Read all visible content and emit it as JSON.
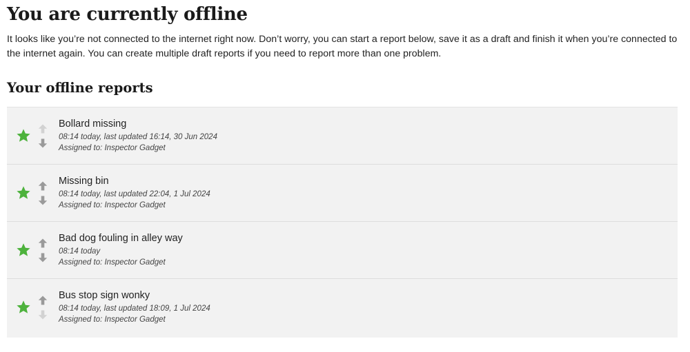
{
  "header": {
    "title": "You are currently offline",
    "intro": "It looks like you’re not connected to the internet right now. Don’t worry, you can start a report below, save it as a draft and finish it when you’re connected to the internet again. You can create multiple draft reports if you need to report more than one problem."
  },
  "reports_section": {
    "title": "Your offline reports",
    "reports": [
      {
        "title": "Bollard missing",
        "meta": "08:14 today, last updated 16:14, 30 Jun 2024",
        "assigned": "Assigned to: Inspector Gadget",
        "starred": true,
        "can_move_up": false,
        "can_move_down": true
      },
      {
        "title": "Missing bin",
        "meta": "08:14 today, last updated 22:04, 1 Jul 2024",
        "assigned": "Assigned to: Inspector Gadget",
        "starred": true,
        "can_move_up": true,
        "can_move_down": true
      },
      {
        "title": "Bad dog fouling in alley way",
        "meta": "08:14 today",
        "assigned": "Assigned to: Inspector Gadget",
        "starred": true,
        "can_move_up": true,
        "can_move_down": true
      },
      {
        "title": "Bus stop sign wonky",
        "meta": "08:14 today, last updated 18:09, 1 Jul 2024",
        "assigned": "Assigned to: Inspector Gadget",
        "starred": true,
        "can_move_up": true,
        "can_move_down": false
      }
    ]
  },
  "colors": {
    "star": "#4db23c",
    "arrow_enabled": "#9a9a9a",
    "arrow_disabled": "#d2d2d2",
    "list_background": "#f2f2f2",
    "divider": "#dddddd"
  },
  "icons": {
    "star": "star-icon",
    "up": "arrow-up-icon",
    "down": "arrow-down-icon"
  }
}
